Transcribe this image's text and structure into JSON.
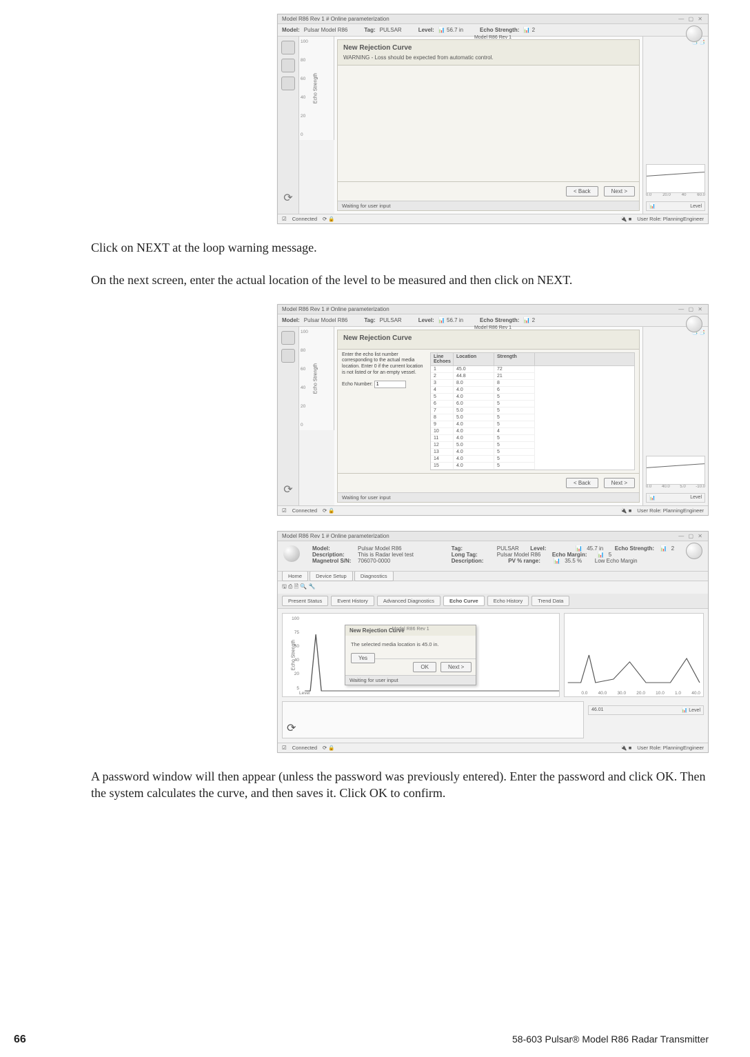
{
  "page": {
    "number": "66",
    "footer_right": "58-603 Pulsar® Model R86 Radar Transmitter"
  },
  "para1": "Click on NEXT at the loop warning message.",
  "para2": "On the next screen, enter the actual location of the level to be measured and then click on NEXT.",
  "para3": "A password window will then appear (unless the password was previously entered). Enter the password and click OK. Then the system calculates the curve, and then saves it. Click OK to confirm.",
  "app_title": "Model R86 Rev 1 # Online parameterization",
  "header": {
    "model_k": "Model:",
    "model_v": "Pulsar Model R86",
    "tag_k": "Tag:",
    "tag_v": "PULSAR",
    "subtitle": "Model R86 Rev 1",
    "level_k": "Level:",
    "level_unit": "in",
    "level_badge_v": "56.7",
    "echo_k": "Echo Strength:",
    "echo_badge_v": "2"
  },
  "wizard1": {
    "title": "New Rejection Curve",
    "warning": "WARNING - Loss should be expected from automatic control.",
    "back": "< Back",
    "next": "Next >",
    "status": "Waiting for user input",
    "yaxis": "Echo Strength",
    "yticks": [
      "100",
      "80",
      "60",
      "40",
      "20",
      "0"
    ]
  },
  "rightpanel": {
    "axis": [
      "0.0",
      "20.0",
      "40",
      "60.0"
    ],
    "readout_label": "Level",
    "readout_icon": "📊"
  },
  "bottombar": {
    "connected": "Connected",
    "user": "User Role: PlanningEngineer"
  },
  "wizard2": {
    "title": "New Rejection Curve",
    "instr": "Enter the echo list number corresponding to the actual media location. Enter 0 if the current location is not listed or for an empty vessel.",
    "echo_num_label": "Echo Number:",
    "echo_num_value": "1",
    "back": "< Back",
    "next": "Next >",
    "status": "Waiting for user input",
    "cols": {
      "n": "Line Echoes",
      "l": "Location",
      "s": "Strength"
    },
    "rows": [
      {
        "n": "1",
        "l": "45.0",
        "s": "72"
      },
      {
        "n": "2",
        "l": "44.8",
        "s": "21"
      },
      {
        "n": "3",
        "l": "8.0",
        "s": "8"
      },
      {
        "n": "4",
        "l": "4.0",
        "s": "6"
      },
      {
        "n": "5",
        "l": "4.0",
        "s": "5"
      },
      {
        "n": "6",
        "l": "6.0",
        "s": "5"
      },
      {
        "n": "7",
        "l": "5.0",
        "s": "5"
      },
      {
        "n": "8",
        "l": "5.0",
        "s": "5"
      },
      {
        "n": "9",
        "l": "4.0",
        "s": "5"
      },
      {
        "n": "10",
        "l": "4.0",
        "s": "4"
      },
      {
        "n": "11",
        "l": "4.0",
        "s": "5"
      },
      {
        "n": "12",
        "l": "5.0",
        "s": "5"
      },
      {
        "n": "13",
        "l": "4.0",
        "s": "5"
      },
      {
        "n": "14",
        "l": "4.0",
        "s": "5"
      },
      {
        "n": "15",
        "l": "4.0",
        "s": "5"
      }
    ]
  },
  "ss3": {
    "top": {
      "model_k": "Model:",
      "model_v": "Pulsar Model R86",
      "desc_k": "Description:",
      "desc_v": "This is Radar level test",
      "ms_k": "Magnetrol S/N:",
      "ms_v": "706070-0000",
      "tag_k": "Tag:",
      "tag_v": "PULSAR",
      "long_k": "Long Tag:",
      "long_v": "Pulsar Model R86",
      "desc2_k": "Description:",
      "desc2_v": "",
      "level_k": "Level:",
      "level_v": "45.7 in",
      "pv_k": "PV % range:",
      "pv_v": "35.5 %",
      "es_k": "Echo Strength:",
      "es_v": "2",
      "em_k": "Echo Margin:",
      "em_v": "5",
      "lem": "Low Echo Margin"
    },
    "tabs": [
      "Present Status",
      "Event History",
      "Advanced Diagnostics",
      "Echo Curve",
      "Echo History",
      "Trend Data"
    ],
    "active_tab": "Echo Curve",
    "yaxis_label": "Echo Strength",
    "yticks": [
      "100",
      "75",
      "50",
      "40",
      "20",
      "5"
    ],
    "xlabel": "Level",
    "xticks_right": [
      "0.0",
      "40.0",
      "30.0",
      "20.0",
      "10.0",
      "1.0",
      "40.0"
    ],
    "dialog": {
      "head": "New Rejection Curve",
      "sub": "Model R86 Rev 1",
      "msg": "The selected media location is 45.0 in.",
      "yes": "Yes",
      "ok": "OK",
      "next": "Next >",
      "status": "Waiting for user input"
    },
    "readouts": {
      "val": "46.01",
      "level_label": "Level"
    }
  }
}
